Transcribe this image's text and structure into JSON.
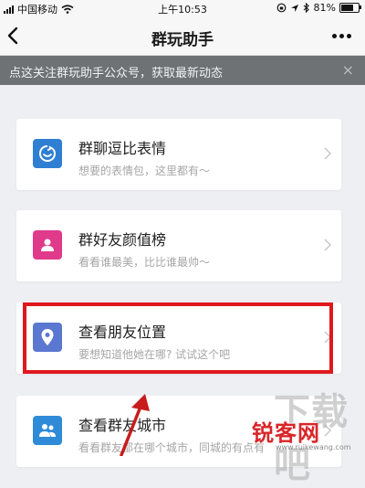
{
  "status_bar": {
    "carrier": "中国移动",
    "time": "上午10:53",
    "battery": "81%",
    "battery_level": 0.81
  },
  "nav": {
    "title": "群玩助手"
  },
  "banner": {
    "text": "点这关注群玩助手公众号，获取最新动态",
    "close": "×"
  },
  "cards": [
    {
      "title": "群聊逗比表情",
      "desc": "想要的表情包，这里都有～",
      "icon": "emoji-icon",
      "color": "#2f7fd3"
    },
    {
      "title": "群好友颜值榜",
      "desc": "看看谁最美，比比谁最帅～",
      "icon": "person-icon",
      "color": "#e03a8b"
    },
    {
      "title": "查看朋友位置",
      "desc": "要想知道他她在哪? 试试这个吧",
      "icon": "location-pin-icon",
      "color": "#5b78d0"
    },
    {
      "title": "查看群友城市",
      "desc": "看看群友都在哪个城市，同城的有点有",
      "icon": "group-icon",
      "color": "#2f8bd8"
    }
  ],
  "watermark": {
    "big": "下载吧",
    "logo": "锐客网",
    "url": "www.ruikewang.com"
  },
  "colors": {
    "highlight": "#e0181e",
    "banner_bg": "#6e7275"
  }
}
